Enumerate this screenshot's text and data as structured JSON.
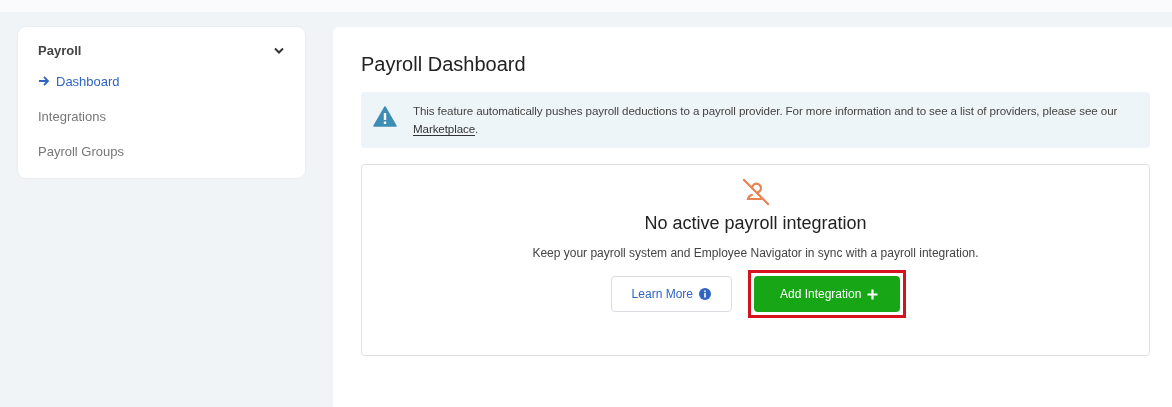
{
  "sidebar": {
    "title": "Payroll",
    "expanded": true,
    "items": [
      {
        "label": "Dashboard",
        "selected": true
      },
      {
        "label": "Integrations",
        "selected": false
      },
      {
        "label": "Payroll Groups",
        "selected": false
      }
    ]
  },
  "page": {
    "title": "Payroll Dashboard",
    "notice": {
      "text": "This feature automatically pushes payroll deductions to a payroll provider. For more information and to see a list of providers, please see our ",
      "link": "Marketplace",
      "end": "."
    },
    "empty_state": {
      "heading": "No active payroll integration",
      "description": "Keep your payroll system and Employee Navigator in sync with a payroll integration.",
      "buttons": [
        {
          "label": "Learn More",
          "kind": "secondary",
          "highlighted": false
        },
        {
          "label": "Add Integration",
          "kind": "primary",
          "highlighted": true
        }
      ]
    }
  }
}
